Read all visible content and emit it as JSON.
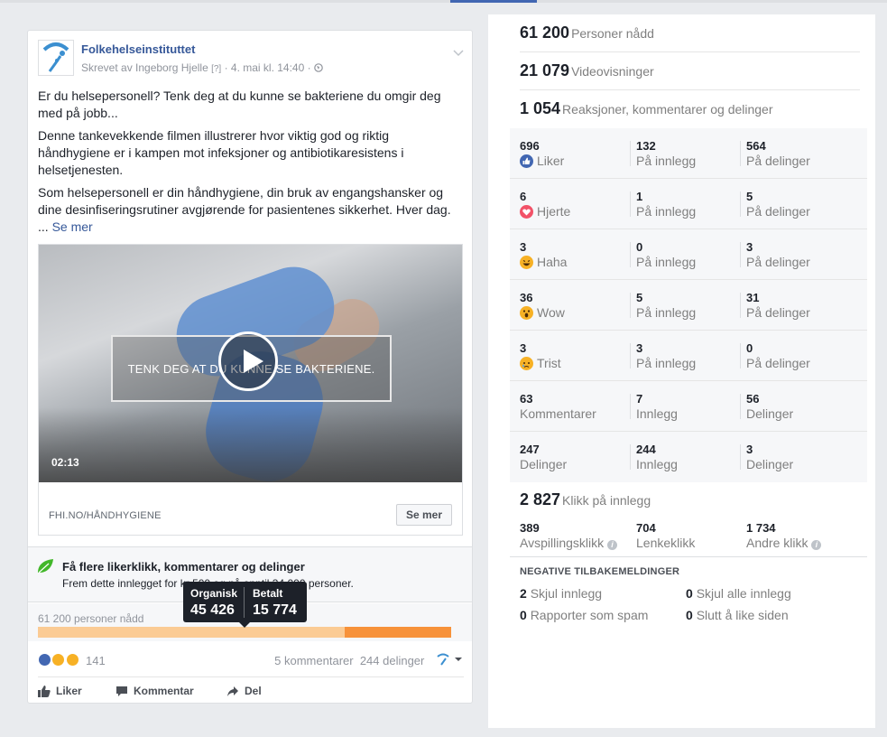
{
  "post": {
    "page_name": "Folkehelseinstituttet",
    "author": "Skrevet av Ingeborg Hjelle",
    "author_hint": "[?]",
    "date": "4. mai kl. 14:40",
    "paragraph1": "Er du helsepersonell? Tenk deg at du kunne se bakteriene du omgir deg med på jobb...",
    "paragraph2": "Denne tankevekkende filmen illustrerer hvor viktig god og riktig håndhygiene er i kampen mot infeksjoner og antibiotikaresistens i helsetjenesten.",
    "paragraph3": "Som helsepersonell er din håndhygiene, din bruk av engangshansker og dine desinfiseringsrutiner avgjørende for pasientenes sikkerhet. Hver dag.",
    "paragraph3_prefix": "...",
    "see_more": "Se mer",
    "video_overlay_text": "TENK DEG AT DU KUNNE SE BAKTERIENE.",
    "video_duration": "02:13",
    "link_domain": "FHI.NO/HÅNDHYGIENE",
    "link_button": "Se mer"
  },
  "boost": {
    "title": "Få flere likerklikk, kommentarer og delinger",
    "subtitle": "Frem dette innlegget for kr 500 og nå opptil 34 000 personer."
  },
  "reach": {
    "label": "61 200 personer nådd",
    "organic_fraction": 0.7423,
    "tooltip": {
      "organic_label": "Organisk",
      "organic_value": "45 426",
      "paid_label": "Betalt",
      "paid_value": "15 774"
    }
  },
  "footer": {
    "reaction_count": "141",
    "comments": "5 kommentarer",
    "shares": "244 delinger",
    "actions": {
      "like": "Liker",
      "comment": "Kommentar",
      "share": "Del"
    }
  },
  "stats": {
    "reached": {
      "n": "61 200",
      "label": "Personer nådd"
    },
    "views": {
      "n": "21 079",
      "label": "Videovisninger"
    },
    "reactions": {
      "n": "1 054",
      "label": "Reaksjoner, kommentarer og delinger"
    },
    "rows": [
      {
        "icon": "like-icon",
        "v1": "696",
        "t1": "Liker",
        "v2": "132",
        "t2": "På innlegg",
        "v3": "564",
        "t3": "På delinger"
      },
      {
        "icon": "heart-icon",
        "v1": "6",
        "t1": "Hjerte",
        "v2": "1",
        "t2": "På innlegg",
        "v3": "5",
        "t3": "På delinger"
      },
      {
        "icon": "haha-icon",
        "v1": "3",
        "t1": "Haha",
        "v2": "0",
        "t2": "På innlegg",
        "v3": "3",
        "t3": "På delinger"
      },
      {
        "icon": "wow-icon",
        "v1": "36",
        "t1": "Wow",
        "v2": "5",
        "t2": "På innlegg",
        "v3": "31",
        "t3": "På delinger"
      },
      {
        "icon": "sad-icon",
        "v1": "3",
        "t1": "Trist",
        "v2": "3",
        "t2": "På innlegg",
        "v3": "0",
        "t3": "På delinger"
      },
      {
        "icon": "",
        "v1": "63",
        "t1": "Kommentarer",
        "v2": "7",
        "t2": "Innlegg",
        "v3": "56",
        "t3": "Delinger"
      },
      {
        "icon": "",
        "v1": "247",
        "t1": "Delinger",
        "v2": "244",
        "t2": "Innlegg",
        "v3": "3",
        "t3": "Delinger"
      }
    ],
    "clicks": {
      "n": "2 827",
      "label": "Klikk på innlegg"
    },
    "click_play": {
      "v": "389",
      "t": "Avspillingsklikk"
    },
    "click_link": {
      "v": "704",
      "t": "Lenkeklikk"
    },
    "click_other": {
      "v": "1 734",
      "t": "Andre klikk"
    },
    "negative_title": "NEGATIVE TILBAKEMELDINGER",
    "neg": {
      "hide_post": {
        "n": "2",
        "t": "Skjul innlegg"
      },
      "hide_all": {
        "n": "0",
        "t": "Skjul alle innlegg"
      },
      "spam": {
        "n": "0",
        "t": "Rapporter som spam"
      },
      "unlike": {
        "n": "0",
        "t": "Slutt å like siden"
      }
    }
  },
  "colors": {
    "link": "#365899",
    "accent": "#4267b2",
    "paid": "#f7923a",
    "organic": "#fbcb94"
  }
}
